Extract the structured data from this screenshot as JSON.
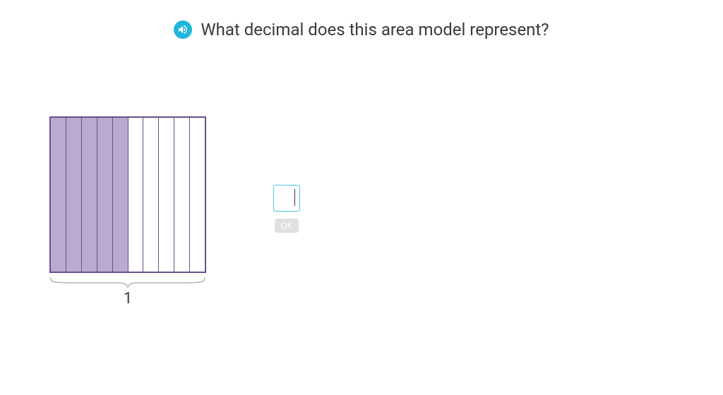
{
  "question": {
    "text": "What decimal does this area model represent?"
  },
  "model": {
    "total_strips": 10,
    "filled_strips": 5,
    "brace_label": "1",
    "fill_color": "#b9aad0",
    "border_color": "#6a4e8e"
  },
  "answer": {
    "value": "",
    "ok_label": "OK"
  }
}
